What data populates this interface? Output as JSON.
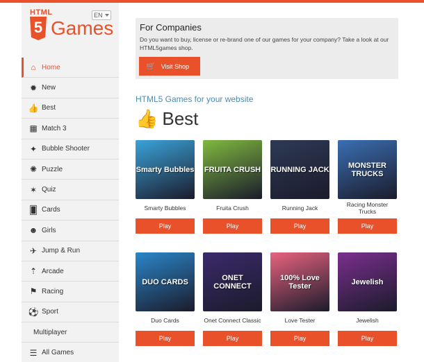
{
  "logo": {
    "html": "HTML",
    "five": "5",
    "games": "Games"
  },
  "language": {
    "selected": "EN"
  },
  "sidebar": {
    "items": [
      {
        "label": "Home",
        "icon": "home-icon",
        "glyph": "⌂",
        "active": true
      },
      {
        "label": "New",
        "icon": "new-badge-icon",
        "glyph": "✹"
      },
      {
        "label": "Best",
        "icon": "thumbs-up-icon",
        "glyph": "👍"
      },
      {
        "label": "Match 3",
        "icon": "grid-icon",
        "glyph": "▦"
      },
      {
        "label": "Bubble Shooter",
        "icon": "shooter-icon",
        "glyph": "✦"
      },
      {
        "label": "Puzzle",
        "icon": "lightbulb-icon",
        "glyph": "✺"
      },
      {
        "label": "Quiz",
        "icon": "quiz-icon",
        "glyph": "✶"
      },
      {
        "label": "Cards",
        "icon": "cards-icon",
        "glyph": "🂠"
      },
      {
        "label": "Girls",
        "icon": "girl-icon",
        "glyph": "☻"
      },
      {
        "label": "Jump & Run",
        "icon": "jump-run-icon",
        "glyph": "✈"
      },
      {
        "label": "Arcade",
        "icon": "rocket-icon",
        "glyph": "⇡"
      },
      {
        "label": "Racing",
        "icon": "racing-flag-icon",
        "glyph": "⚑"
      },
      {
        "label": "Sport",
        "icon": "soccer-ball-icon",
        "glyph": "⚽"
      },
      {
        "label": "Multiplayer",
        "icon": "",
        "glyph": ""
      },
      {
        "label": "All Games",
        "icon": "menu-icon",
        "glyph": "☰"
      }
    ]
  },
  "companies": {
    "title": "For Companies",
    "text": "Do you want to buy, license or re-brand one of our games for your company? Take a look at our HTML5games shop.",
    "button": "Visit Shop"
  },
  "section": {
    "subtitle": "HTML5 Games for your website",
    "title": "Best"
  },
  "games": [
    {
      "name": "Smarty Bubbles",
      "art": "Smarty Bubbles",
      "play": "Play",
      "bg": "#3aa3d9"
    },
    {
      "name": "Fruita Crush",
      "art": "FRUITA CRUSH",
      "play": "Play",
      "bg": "#7fb93f"
    },
    {
      "name": "Running Jack",
      "art": "RUNNING JACK",
      "play": "Play",
      "bg": "#2d3a55"
    },
    {
      "name": "Racing Monster Trucks",
      "art": "MONSTER TRUCKS",
      "play": "Play",
      "bg": "#3a6fb3"
    },
    {
      "name": "Duo Cards",
      "art": "DUO CARDS",
      "play": "Play",
      "bg": "#2a86c9"
    },
    {
      "name": "Onet Connect Classic",
      "art": "ONET CONNECT",
      "play": "Play",
      "bg": "#3b2a6b"
    },
    {
      "name": "Love Tester",
      "art": "100% Love Tester",
      "play": "Play",
      "bg": "#e8637f"
    },
    {
      "name": "Jewelish",
      "art": "Jewelish",
      "play": "Play",
      "bg": "#7a2f8e"
    }
  ],
  "colors": {
    "accent": "#e8512a",
    "sidebar": "#f2f2f2",
    "subtitle": "#4a8bb0"
  }
}
